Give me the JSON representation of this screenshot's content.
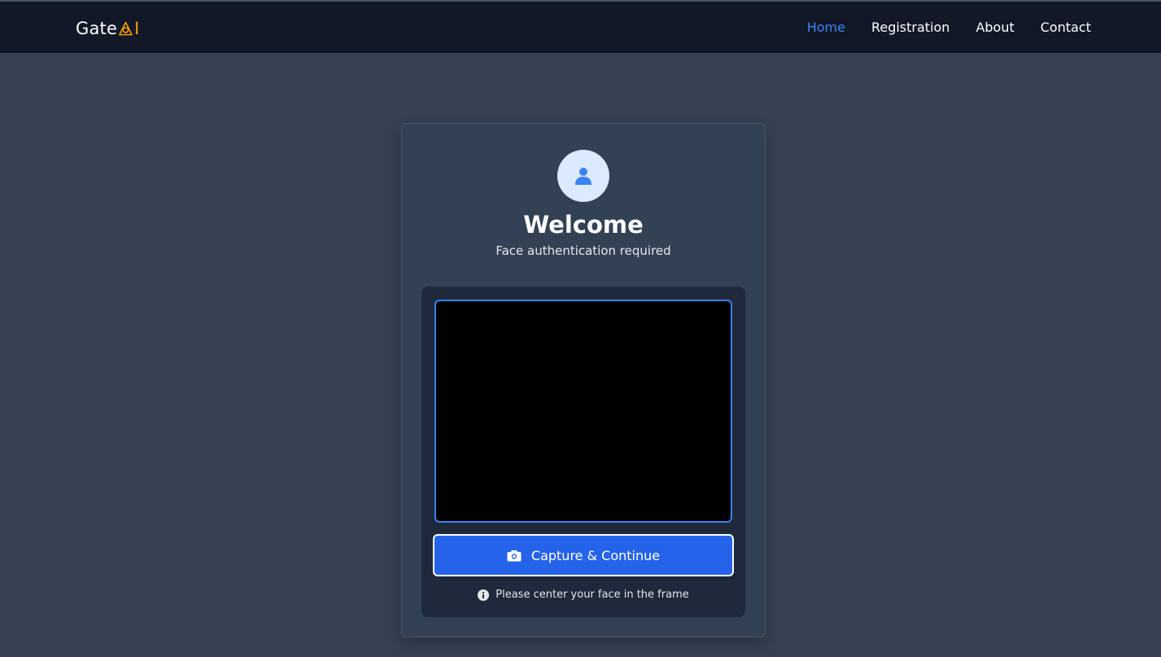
{
  "brand": {
    "name_prefix": "Gate",
    "name_suffix": "I"
  },
  "nav": {
    "items": [
      {
        "label": "Home",
        "active": true
      },
      {
        "label": "Registration",
        "active": false
      },
      {
        "label": "About",
        "active": false
      },
      {
        "label": "Contact",
        "active": false
      }
    ]
  },
  "card": {
    "avatar_icon": "user-icon",
    "title": "Welcome",
    "subtitle": "Face authentication required",
    "capture_button_label": "Capture & Continue",
    "capture_button_icon": "camera-icon",
    "hint_icon": "info-icon",
    "hint": "Please center your face in the frame"
  },
  "colors": {
    "accent": "#3b82f6",
    "button": "#2563eb",
    "nav_bg": "#111827",
    "page_bg": "#374151",
    "card_bg": "#334155",
    "logo_accent": "#f59e0b"
  }
}
